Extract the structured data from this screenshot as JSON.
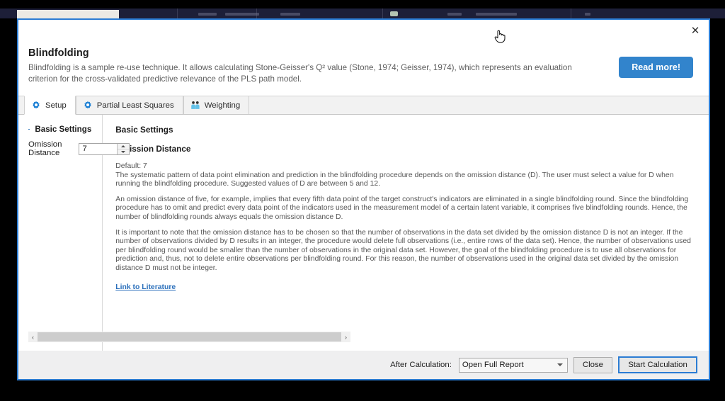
{
  "dialog": {
    "title": "Blindfolding",
    "description": "Blindfolding is a sample re-use technique. It allows calculating Stone-Geisser's Q² value (Stone, 1974; Geisser, 1974), which represents an evaluation criterion for the cross-validated predictive relevance of the PLS path model.",
    "read_more_label": "Read more!",
    "close_label": "✕",
    "accent_color": "#2b7cd3",
    "read_more_color": "#3284cc"
  },
  "tabs": [
    {
      "label": "Setup",
      "icon": "gear-icon",
      "active": true
    },
    {
      "label": "Partial Least Squares",
      "icon": "gear-icon",
      "active": false
    },
    {
      "label": "Weighting",
      "icon": "people-icon",
      "active": false
    }
  ],
  "settings_panel": {
    "group_title": "Basic Settings",
    "omission_distance": {
      "label": "Omission Distance",
      "value": "7"
    },
    "scrollbar": {
      "left_arrow": "‹",
      "right_arrow": "›"
    }
  },
  "documentation": {
    "heading": "Basic Settings",
    "subheading": "Omission Distance",
    "paragraphs": [
      "Default: 7",
      "The systematic pattern of data point elimination and prediction in the blindfolding procedure depends on the omission distance (D). The user must select a value for D when running the blindfolding procedure. Suggested values of D are between 5 and 12.",
      "An omission distance of five, for example, implies that every fifth data point of the target construct's indicators are eliminated in a single blindfolding round. Since the blindfolding procedure has to omit and predict every data point of the indicators used in the measurement model of a certain latent variable, it comprises five blindfolding rounds. Hence, the number of blindfolding rounds always equals the omission distance D.",
      "It is important to note that the omission distance has to be chosen so that the number of observations in the data set divided by the omission distance D is not an integer. If the number of observations divided by D results in an integer, the procedure would delete full observations (i.e., entire rows of the data set). Hence, the number of observations used per blindfolding round would be smaller than the number of observations in the original data set. However, the goal of the blindfolding procedure is to use all observations for prediction and, thus, not to delete entire observations per blindfolding round. For this reason, the number of observations used in the original data set divided by the omission distance D must not be integer."
    ],
    "link_label": "Link to Literature",
    "link_color": "#2a6fbb"
  },
  "footer": {
    "after_calculation_label": "After Calculation:",
    "after_calculation_value": "Open Full Report",
    "after_calculation_options": [
      "Open Full Report"
    ],
    "close_label": "Close",
    "start_label": "Start Calculation"
  }
}
